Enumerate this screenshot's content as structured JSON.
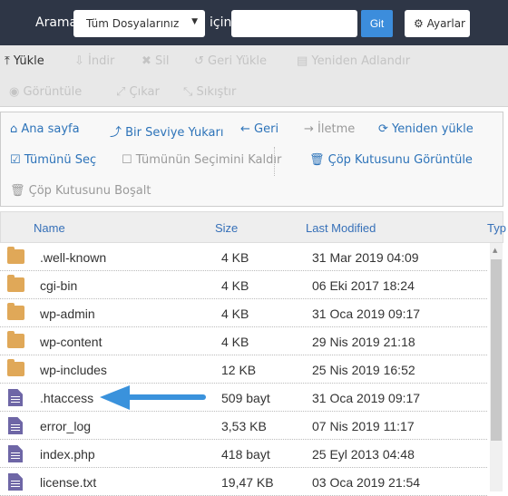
{
  "header": {
    "search_label": "Arama",
    "scope": "Tüm Dosyalarınız",
    "for_label": "için",
    "search_value": "",
    "go": "Git",
    "settings": "Ayarlar"
  },
  "toolbar": [
    {
      "label": "Yükle",
      "icon": "upload-icon",
      "enabled": true
    },
    {
      "label": "İndir",
      "icon": "download-icon",
      "enabled": false
    },
    {
      "label": "Sil",
      "icon": "close-icon",
      "enabled": false
    },
    {
      "label": "Geri Yükle",
      "icon": "undo-icon",
      "enabled": false
    },
    {
      "label": "Yeniden Adlandır",
      "icon": "file-icon",
      "enabled": false
    },
    {
      "label": "Görüntüle",
      "icon": "eye-icon",
      "enabled": false
    },
    {
      "label": "Çıkar",
      "icon": "expand-icon",
      "enabled": false
    },
    {
      "label": "Sıkıştır",
      "icon": "compress-icon",
      "enabled": false
    }
  ],
  "nav": [
    {
      "label": "Ana sayfa",
      "icon": "home-icon",
      "enabled": true
    },
    {
      "label": "Bir Seviye Yukarı",
      "icon": "level-up-icon",
      "enabled": true
    },
    {
      "label": "Geri",
      "icon": "arrow-left-icon",
      "enabled": true
    },
    {
      "label": "İletme",
      "icon": "arrow-right-icon",
      "enabled": false
    },
    {
      "label": "Yeniden yükle",
      "icon": "refresh-icon",
      "enabled": true
    },
    {
      "label": "Tümünü Seç",
      "icon": "checkbox-checked-icon",
      "enabled": true
    },
    {
      "label": "Tümünün Seçimini Kaldır",
      "icon": "checkbox-empty-icon",
      "enabled": false
    },
    {
      "label": "Çöp Kutusunu Görüntüle",
      "icon": "trash-icon",
      "enabled": true
    },
    {
      "label": "Çöp Kutusunu Boşalt",
      "icon": "trash-icon",
      "enabled": false
    }
  ],
  "table": {
    "columns": [
      "Name",
      "Size",
      "Last Modified",
      "Typ"
    ],
    "rows": [
      {
        "type": "folder",
        "name": ".well-known",
        "size": "4 KB",
        "modified": "31 Mar 2019 04:09"
      },
      {
        "type": "folder",
        "name": "cgi-bin",
        "size": "4 KB",
        "modified": "06 Eki 2017 18:24"
      },
      {
        "type": "folder",
        "name": "wp-admin",
        "size": "4 KB",
        "modified": "31 Oca 2019 09:17"
      },
      {
        "type": "folder",
        "name": "wp-content",
        "size": "4 KB",
        "modified": "29 Nis 2019 21:18"
      },
      {
        "type": "folder",
        "name": "wp-includes",
        "size": "12 KB",
        "modified": "25 Nis 2019 16:52"
      },
      {
        "type": "file",
        "name": ".htaccess",
        "size": "509 bayt",
        "modified": "31 Oca 2019 09:17"
      },
      {
        "type": "file",
        "name": "error_log",
        "size": "3,53 KB",
        "modified": "07 Nis 2019 11:17"
      },
      {
        "type": "file",
        "name": "index.php",
        "size": "418 bayt",
        "modified": "25 Eyl 2013 04:48"
      },
      {
        "type": "file",
        "name": "license.txt",
        "size": "19,47 KB",
        "modified": "03 Oca 2019 21:54"
      }
    ]
  },
  "colors": {
    "header_bg": "#2e3646",
    "accent": "#3c8ddc",
    "link": "#2d73b9",
    "folder": "#e0a858",
    "file": "#6e66a6"
  }
}
